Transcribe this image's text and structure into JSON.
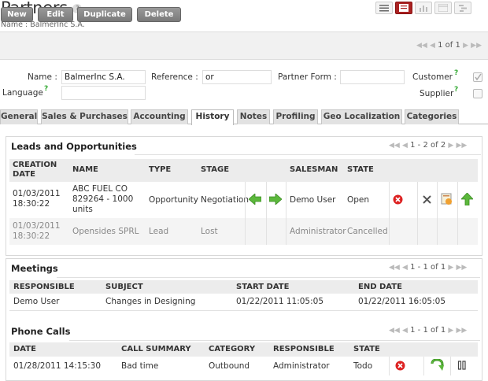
{
  "page": {
    "title": "Partners",
    "help": "?",
    "subtitle": "Name : BalmerInc S.A."
  },
  "toolbar": {
    "new_label": "New",
    "edit_label": "Edit",
    "duplicate_label": "Duplicate",
    "delete_label": "Delete",
    "pager": "1 of 1"
  },
  "form": {
    "name_label": "Name :",
    "name_value": "BalmerInc S.A.",
    "reference_label": "Reference :",
    "reference_value": "or",
    "partner_form_label": "Partner Form :",
    "partner_form_value": "",
    "customer_label": "Customer",
    "customer_checked": true,
    "language_label": "Language",
    "language_value": "",
    "supplier_label": "Supplier",
    "supplier_checked": false,
    "help_mark": "?"
  },
  "tabs": [
    "General",
    "Sales & Purchases",
    "Accounting",
    "History",
    "Notes",
    "Profiling",
    "Geo Localization",
    "Categories"
  ],
  "active_tab": "History",
  "leads": {
    "title": "Leads and Opportunities",
    "pager": "1 - 2 of 2",
    "header_creation_1": "CREATION",
    "header_creation_2": "DATE",
    "headers": {
      "name": "NAME",
      "type": "TYPE",
      "stage": "STAGE",
      "salesman": "SALESMAN",
      "state": "STATE"
    },
    "rows": [
      {
        "date": "01/03/2011",
        "time": "18:30:22",
        "name1": "ABC FUEL CO",
        "name2": "829264 - 1000",
        "name3": "units",
        "type": "Opportunity",
        "stage": "Negotiation",
        "salesman": "Demo User",
        "state": "Open"
      },
      {
        "date": "01/03/2011",
        "time": "18:30:22",
        "name1": "Opensides SPRL",
        "type": "Lead",
        "stage": "Lost",
        "salesman": "Administrator",
        "state": "Cancelled"
      }
    ]
  },
  "meetings": {
    "title": "Meetings",
    "pager": "1 - 1 of 1",
    "headers": {
      "responsible": "RESPONSIBLE",
      "subject": "SUBJECT",
      "start": "START DATE",
      "end": "END DATE"
    },
    "rows": [
      {
        "responsible": "Demo User",
        "subject": "Changes in Designing",
        "start": "01/22/2011 11:05:05",
        "end": "01/22/2011 16:05:05"
      }
    ]
  },
  "calls": {
    "title": "Phone Calls",
    "pager": "1 - 1 of 1",
    "headers": {
      "date": "DATE",
      "summary": "CALL SUMMARY",
      "category": "CATEGORY",
      "responsible": "RESPONSIBLE",
      "state": "STATE"
    },
    "rows": [
      {
        "date": "01/28/2011 14:15:30",
        "summary": "Bad time",
        "category": "Outbound",
        "responsible": "Administrator",
        "state": "Todo"
      }
    ]
  },
  "colors": {
    "accent": "#a22222",
    "button": "#888888",
    "green": "#4aa832",
    "red": "#d22222"
  }
}
